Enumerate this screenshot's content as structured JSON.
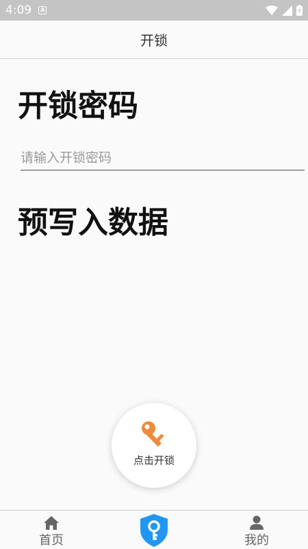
{
  "status_bar": {
    "time": "4:09",
    "notification_letter": "A"
  },
  "header": {
    "title": "开锁"
  },
  "password_section": {
    "title": "开锁密码",
    "input_placeholder": "请输入开锁密码",
    "input_value": ""
  },
  "prewrite_section": {
    "title": "预写入数据"
  },
  "unlock_button": {
    "label": "点击开锁",
    "icon": "key-icon",
    "icon_color": "#f08a3c"
  },
  "bottom_nav": {
    "items": [
      {
        "label": "首页",
        "icon": "home-icon"
      },
      {
        "label": "",
        "icon": "shield-key-icon",
        "color": "#2196f3"
      },
      {
        "label": "我的",
        "icon": "person-icon"
      }
    ]
  },
  "colors": {
    "status_bar": "#c4c4c4",
    "background": "#fafafa",
    "accent": "#2196f3",
    "key": "#f08a3c"
  }
}
